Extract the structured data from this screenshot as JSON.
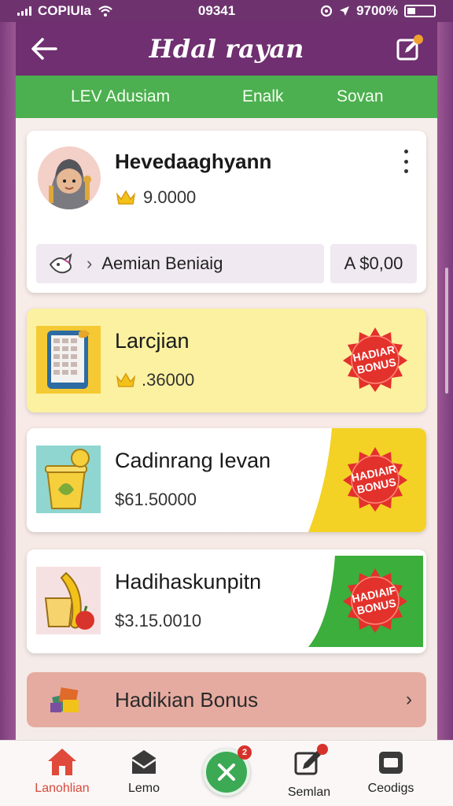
{
  "status_bar": {
    "carrier": "COPIUIa",
    "time": "09341",
    "battery": "9700%"
  },
  "header": {
    "title": "Hdal rayan"
  },
  "tabs": [
    "LEV Adusiam",
    "Enalk",
    "Sovan"
  ],
  "profile": {
    "name": "Hevedaaghyann",
    "coins": "9.0000",
    "row_label": "Aemian Beniaig",
    "amount": "A $0,00"
  },
  "offers": [
    {
      "title": "Larcjian",
      "price": ".36000",
      "badge": "HADIAR BONUS"
    },
    {
      "title": "Cadinrang Ievan",
      "price": "$61.50000",
      "badge": "HADIAIR BONUS"
    },
    {
      "title": "Hadihaskunpitn",
      "price": "$3.15.0010",
      "badge": "HADIAIF BONUS"
    }
  ],
  "bonus_row": {
    "label": "Hadikian Bonus"
  },
  "bottom_nav": [
    {
      "label": "Lanohlian",
      "icon": "home-icon"
    },
    {
      "label": "Lemo",
      "icon": "mail-icon"
    },
    {
      "label": "",
      "icon": "close-icon",
      "badge": "2"
    },
    {
      "label": "Semlan",
      "icon": "edit-icon"
    },
    {
      "label": "Ceodigs",
      "icon": "box-icon"
    }
  ],
  "colors": {
    "primary_purple": "#6f2f70",
    "tab_green": "#4caf50",
    "offer_yellow": "#fbf1a0",
    "badge_red": "#e3312b",
    "bonus_row": "#e6aba0",
    "accent_red": "#d84a3a"
  }
}
